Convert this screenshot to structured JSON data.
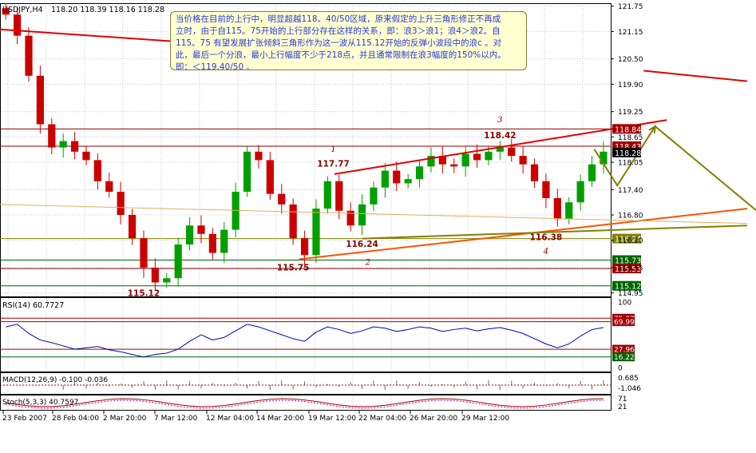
{
  "header": {
    "symbol": "USDJPY,H4",
    "ohlc": "118.20 118.39 118.16 118.28"
  },
  "annotation": {
    "lines": [
      "当价格在目前的上行中，明显超越118。40/50区域，原来假定的上升三角形修正不再成",
      "立时，由于自115。75开始的上行部分存在这样的关系，即：浪3＞浪1；浪4＞浪2。自",
      "115。75 有望发展扩张倾斜三角形作为这一波从115.12开始的反弹小波段中的浪c 。对",
      "此，最后一个分浪，最小上行幅度不少于218点，并且通常限制在浪3幅度的150%以内。",
      "即：＜119.40/50 。"
    ]
  },
  "colors": {
    "up_candle": "#00a000",
    "down_candle": "#cc0000",
    "rsi_line": "#0000c0",
    "wedge_line": "#e00000",
    "lower_trend": "#ff5000",
    "projection": "#808000",
    "level_red": "#8b0000",
    "level_green": "#006400"
  },
  "chart_data": [
    {
      "type": "candlestick",
      "title": "USDJPY,H4",
      "x_tick_labels": [
        "23 Feb 2007",
        "28 Feb 04:00",
        "2 Mar 20:00",
        "7 Mar 12:00",
        "12 Mar 04:00",
        "14 Mar 20:00",
        "19 Mar 12:00",
        "22 Mar 04:00",
        "26 Mar 20:00",
        "29 Mar 12:00"
      ],
      "y_tick_labels": [
        "121.75",
        "121.15",
        "120.50",
        "119.90",
        "119.25",
        "118.65",
        "118.05",
        "117.40",
        "116.80",
        "116.20",
        "115.55",
        "114.95"
      ],
      "ylim": [
        114.85,
        121.82
      ],
      "close_path": [
        121.55,
        121.05,
        120.1,
        118.95,
        118.4,
        118.55,
        118.3,
        118.1,
        117.6,
        117.35,
        116.8,
        116.25,
        115.55,
        115.2,
        115.3,
        116.1,
        116.55,
        116.35,
        115.9,
        116.45,
        117.35,
        118.3,
        118.1,
        117.3,
        117.05,
        116.25,
        115.85,
        116.95,
        117.6,
        116.9,
        116.55,
        117.05,
        117.45,
        117.85,
        117.55,
        117.65,
        117.95,
        118.2,
        118.0,
        117.95,
        118.25,
        118.1,
        118.3,
        118.4,
        118.2,
        118.0,
        117.6,
        117.2,
        116.7,
        117.1,
        117.6,
        118.0,
        118.3
      ],
      "levels": [
        {
          "value": 118.84,
          "label": "118.84",
          "tag": "red"
        },
        {
          "value": 118.43,
          "label": "118.43",
          "tag": "red"
        },
        {
          "value": 118.28,
          "label": "118.28",
          "tag": "current"
        },
        {
          "value": 116.24,
          "label": "116.24",
          "tag": "olive"
        },
        {
          "value": 115.73,
          "label": "115.73",
          "tag": "green"
        },
        {
          "value": 115.53,
          "label": "115.53",
          "tag": "red"
        },
        {
          "value": 115.12,
          "label": "115.12",
          "tag": "green"
        }
      ],
      "price_labels": [
        {
          "text": "117.77",
          "i": 28.5,
          "y": 117.95
        },
        {
          "text": "118.42",
          "i": 43,
          "y": 118.62
        },
        {
          "text": "116.24",
          "i": 31,
          "y": 116.04
        },
        {
          "text": "116.38",
          "i": 47,
          "y": 116.2
        },
        {
          "text": "115.75",
          "i": 25,
          "y": 115.48
        },
        {
          "text": "115.12",
          "i": 12,
          "y": 114.88
        }
      ],
      "wave_labels": [
        {
          "text": "1",
          "i": 28.5,
          "y": 118.3
        },
        {
          "text": "2",
          "i": 31.5,
          "y": 115.62
        },
        {
          "text": "3",
          "i": 43,
          "y": 119.0
        },
        {
          "text": "4",
          "i": 47,
          "y": 115.88
        }
      ],
      "trendlines": [
        {
          "name": "upper-downtrend-line",
          "color": "red",
          "points": [
            [
              -0.5,
              121.2
            ],
            [
              26,
              120.7
            ]
          ]
        },
        {
          "name": "upper-downtrend-line-right",
          "color": "red",
          "points": [
            [
              55.5,
              120.22
            ],
            [
              64.5,
              119.97
            ]
          ]
        },
        {
          "name": "wedge-upper-line",
          "color": "red",
          "points": [
            [
              28.6,
              117.77
            ],
            [
              57.5,
              119.05
            ]
          ]
        },
        {
          "name": "wedge-lower-line",
          "color": "orange",
          "points": [
            [
              25.5,
              115.75
            ],
            [
              64.5,
              116.95
            ]
          ]
        },
        {
          "name": "olive-support-line",
          "color": "olive",
          "points": [
            [
              31,
              116.24
            ],
            [
              64.5,
              116.55
            ]
          ]
        },
        {
          "name": "tan-line",
          "color": "tan",
          "points": [
            [
              -0.5,
              117.05
            ],
            [
              64.5,
              116.6
            ]
          ]
        }
      ],
      "projection": [
        [
          51.2,
          118.36
        ],
        [
          53.2,
          117.5
        ],
        [
          56.5,
          118.9
        ],
        [
          71.5,
          115.5
        ]
      ]
    },
    {
      "type": "line",
      "title": "RSI(14) 60.7727",
      "y_tick_labels": [
        "100",
        "0"
      ],
      "ylim": [
        0,
        100
      ],
      "levels": [
        {
          "value": 75.27,
          "label": "75.27"
        },
        {
          "value": 69.99,
          "label": "69.99"
        },
        {
          "value": 27.96,
          "label": "27.96"
        },
        {
          "value": 16.22,
          "label": "16.22"
        }
      ],
      "values": [
        62,
        66,
        52,
        42,
        38,
        33,
        28,
        30,
        32,
        27,
        24,
        20,
        16,
        20,
        22,
        28,
        40,
        50,
        42,
        46,
        56,
        66,
        62,
        56,
        50,
        44,
        40,
        54,
        62,
        58,
        52,
        56,
        62,
        60,
        55,
        58,
        62,
        60,
        55,
        58,
        60,
        56,
        59,
        61,
        57,
        52,
        44,
        36,
        30,
        36,
        48,
        58,
        61
      ]
    },
    {
      "type": "bar",
      "title": "MACD(12,26,9) -0.100 -0.036",
      "y_tick_labels": [
        "0.685",
        "-1.046"
      ]
    },
    {
      "type": "line",
      "title": "Stoch(5,3,3) 40.7597",
      "y_tick_labels": [
        "71",
        "21"
      ]
    }
  ]
}
